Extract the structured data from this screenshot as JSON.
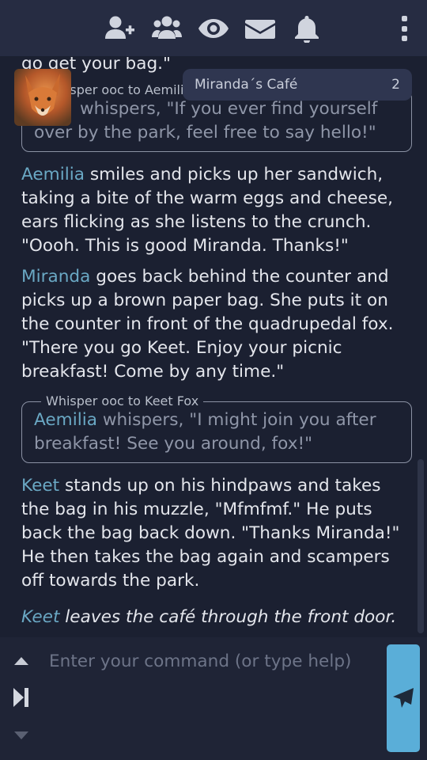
{
  "toolbar": {
    "icons": [
      "add-user-icon",
      "group-icon",
      "eye-icon",
      "mail-icon",
      "bell-icon"
    ],
    "menu_icon": "vertical-dots-icon"
  },
  "room": {
    "name": "Miranda´s Café",
    "count": "2"
  },
  "messages": {
    "m0_text": "go get your bag.\"",
    "w1_label": "Whisper ooc to Aemilia",
    "w1_text": "whispers, \"If you ever find yourself over by the park, feel free to say hello!\"",
    "m2_name": "Aemilia",
    "m2_text": " smiles and picks up her sandwich, taking a bite of the warm eggs and cheese, ears flicking as she listens to the crunch. \"Oooh. This is good Miranda. Thanks!\"",
    "m3_name": "Miranda",
    "m3_text": " goes back behind the counter and picks up a brown paper bag. She puts it on the counter in front of the quadrupedal fox. \"There you go Keet. Enjoy your picnic breakfast! Come by any time.\"",
    "w4_label": "Whisper ooc to Keet Fox",
    "w4_name": "Aemilia",
    "w4_text": " whispers, \"I might join you after breakfast! See you around, fox!\"",
    "m5_name": "Keet",
    "m5_text": " stands up on his hindpaws and takes the bag in his muzzle, \"Mfmfmf.\" He puts back the bag back down. \"Thanks Miranda!\" He then takes the bag again and scampers off towards the park.",
    "m6_name": "Keet",
    "m6_text": " leaves the café through the front door."
  },
  "command": {
    "placeholder": "Enter your command (or type help)",
    "value": ""
  },
  "colors": {
    "accent": "#5aaed8",
    "name": "#6aa8c4",
    "background": "#1b2031",
    "topbar": "#262c42"
  }
}
